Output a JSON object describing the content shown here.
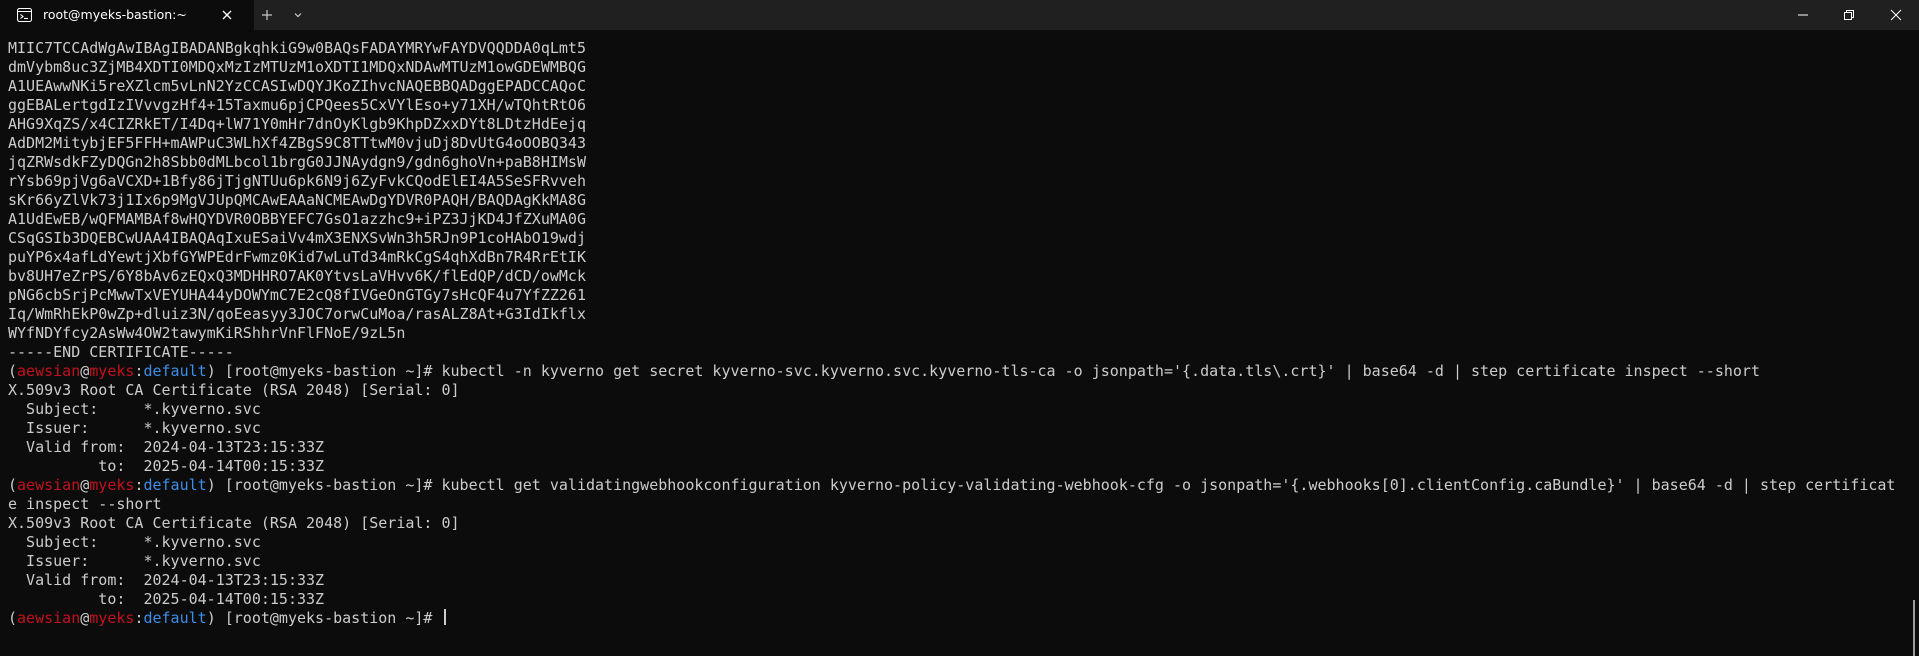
{
  "window": {
    "tab_title": "root@myeks-bastion:~",
    "icons": {
      "tab_icon": "terminal-icon",
      "tab_close": "close-icon",
      "new_tab": "plus-icon",
      "dropdown": "chevron-down-icon",
      "minimize": "minimize-icon",
      "maximize": "maximize-icon",
      "close": "close-icon"
    }
  },
  "colors": {
    "background": "#0c0c0c",
    "text": "#cccccc",
    "prompt_user": "#c50f1f",
    "prompt_context": "#3b8eea"
  },
  "prompt": {
    "open": "(",
    "user": "aewsian",
    "at": "@",
    "host": "myeks",
    "colon": ":",
    "context": "default",
    "rest": ") [root@myeks-bastion ~]# "
  },
  "terminal": {
    "cert_lines": [
      "MIIC7TCCAdWgAwIBAgIBADANBgkqhkiG9w0BAQsFADAYMRYwFAYDVQQDDA0qLmt5",
      "dmVybm8uc3ZjMB4XDTI0MDQxMzIzMTUzM1oXDTI1MDQxNDAwMTUzM1owGDEWMBQG",
      "A1UEAwwNKi5reXZlcm5vLnN2YzCCASIwDQYJKoZIhvcNAQEBBQADggEPADCCAQoC",
      "ggEBALertgdIzIVvvgzHf4+15Taxmu6pjCPQees5CxVYlEso+y71XH/wTQhtRtO6",
      "AHG9XqZS/x4CIZRkET/I4Dq+lW71Y0mHr7dnOyKlgb9KhpDZxxDYt8LDtzHdEejq",
      "AdDM2MitybjEF5FFH+mAWPuC3WLhXf4ZBgS9C8TTtwM0vjuDj8DvUtG4oOOBQ343",
      "jqZRWsdkFZyDQGn2h8Sbb0dMLbcol1brgG0JJNAydgn9/gdn6ghoVn+paB8HIMsW",
      "rYsb69pjVg6aVCXD+1Bfy86jTjgNTUu6pk6N9j6ZyFvkCQodElEI4A5SeSFRvveh",
      "sKr66yZlVk73j1Ix6p9MgVJUpQMCAwEAAaNCMEAwDgYDVR0PAQH/BAQDAgKkMA8G",
      "A1UdEwEB/wQFMAMBAf8wHQYDVR0OBBYEFC7GsO1azzhc9+iPZ3JjKD4JfZXuMA0G",
      "CSqGSIb3DQEBCwUAA4IBAQAqIxuESaiVv4mX3ENXSvWn3h5RJn9P1coHAbO19wdj",
      "puYP6x4afLdYewtjXbfGYWPEdrFwmz0Kid7wLuTd34mRkCgS4qhXdBn7R4RrEtIK",
      "bv8UH7eZrPS/6Y8bAv6zEQxQ3MDHHRO7AK0YtvsLaVHvv6K/flEdQP/dCD/owMck",
      "pNG6cbSrjPcMwwTxVEYUHA44yDOWYmC7E2cQ8fIVGeOnGTGy7sHcQF4u7YfZZ261",
      "Iq/WmRhEkP0wZp+dluiz3N/qoEeasyy3JOC7orwCuMoa/rasALZ8At+G3IdIkflx",
      "WYfNDYfcy2AsWw4OW2tawymKiRShhrVnFlFNoE/9zL5n",
      "-----END CERTIFICATE-----"
    ],
    "cmd1": "kubectl -n kyverno get secret kyverno-svc.kyverno.svc.kyverno-tls-ca -o jsonpath='{.data.tls\\.crt}' | base64 -d | step certificate inspect --short",
    "out1": [
      "X.509v3 Root CA Certificate (RSA 2048) [Serial: 0]",
      "  Subject:     *.kyverno.svc",
      "  Issuer:      *.kyverno.svc",
      "  Valid from:  2024-04-13T23:15:33Z",
      "          to:  2025-04-14T00:15:33Z"
    ],
    "cmd2": "kubectl get validatingwebhookconfiguration kyverno-policy-validating-webhook-cfg -o jsonpath='{.webhooks[0].clientConfig.caBundle}' | base64 -d | step certificat",
    "cmd2_wrap": "e inspect --short",
    "out2": [
      "X.509v3 Root CA Certificate (RSA 2048) [Serial: 0]",
      "  Subject:     *.kyverno.svc",
      "  Issuer:      *.kyverno.svc",
      "  Valid from:  2024-04-13T23:15:33Z",
      "          to:  2025-04-14T00:15:33Z"
    ]
  }
}
